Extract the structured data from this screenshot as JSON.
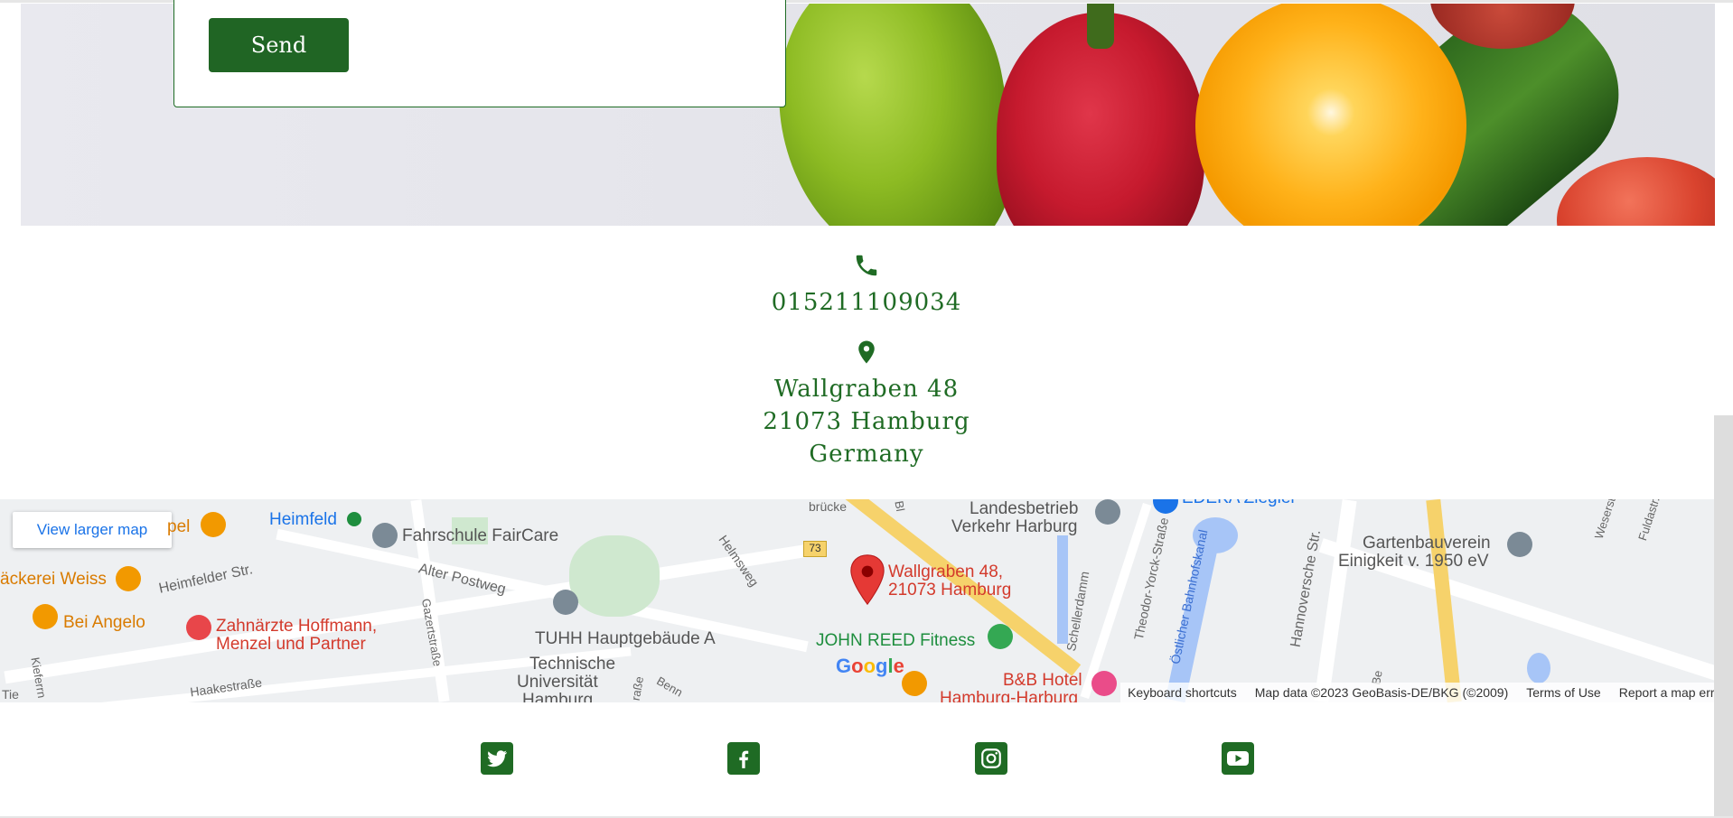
{
  "form": {
    "send_label": "Send"
  },
  "contact": {
    "phone": "015211109034",
    "address_line1": "Wallgraben 48",
    "address_line2": "21073 Hamburg",
    "address_line3": "Germany"
  },
  "map": {
    "view_larger_label": "View larger map",
    "marker_label_1": "Wallgraben 48,",
    "marker_label_2": "21073 Hamburg",
    "route_number": "73",
    "labels": {
      "heimfeld": "Heimfeld",
      "fahrschule": "Fahrschule FairCare",
      "landesbetrieb_1": "Landesbetrieb",
      "landesbetrieb_2": "Verkehr Harburg",
      "edeka": "EDEKA Ziegler",
      "gartenbau_1": "Gartenbauverein",
      "gartenbau_2": "Einigkeit v. 1950 eV",
      "baeckerei": "äckerei Weiss",
      "pel": "pel",
      "bei_angelo": "Bei Angelo",
      "zahnaerzte_1": "Zahnärzte Hoffmann,",
      "zahnaerzte_2": "Menzel und Partner",
      "tuhh": "TUHH Hauptgebäude A",
      "tu_1": "Technische",
      "tu_2": "Universität",
      "tu_3": "Hamburg",
      "john_reed": "JOHN REED Fitness",
      "bb_hotel_1": "B&B Hotel",
      "bb_hotel_2": "Hamburg-Harburg",
      "heimfelder_str": "Heimfelder Str.",
      "alter_postweg": "Alter Postweg",
      "gazertstrasse": "Gazertstraße",
      "haakestrasse": "Haakestraße",
      "helmsweg": "Helmsweg",
      "schellerdamm": "Schellerdamm",
      "theodor": "Theodor-Yorck-Straße",
      "bahnhofskanal": "Östlicher Bahnhofskanal",
      "hannoversche": "Hannoversche Str.",
      "bruecke": "brücke",
      "kieferny": "Kieferrn",
      "tie": "Tie",
      "bl": "Bl",
      "benn": "Benn",
      "strasse": "raße",
      "be": "Be",
      "westerstr": "Weserstr.",
      "fuldastr": "Fuldastr.",
      "a": "A"
    },
    "google": "Google",
    "footer": {
      "shortcuts": "Keyboard shortcuts",
      "map_data": "Map data ©2023 GeoBasis-DE/BKG (©2009)",
      "terms": "Terms of Use",
      "report": "Report a map error"
    },
    "colors": {
      "water": "#a7c5f7",
      "park": "#cfe8cf",
      "highway": "#f6d26b",
      "marker": "#e53935"
    }
  },
  "social": {
    "icons": [
      "twitter-icon",
      "facebook-icon",
      "instagram-icon",
      "youtube-icon"
    ]
  },
  "colors": {
    "brand_green": "#1f6b24",
    "button_green": "#206524"
  }
}
